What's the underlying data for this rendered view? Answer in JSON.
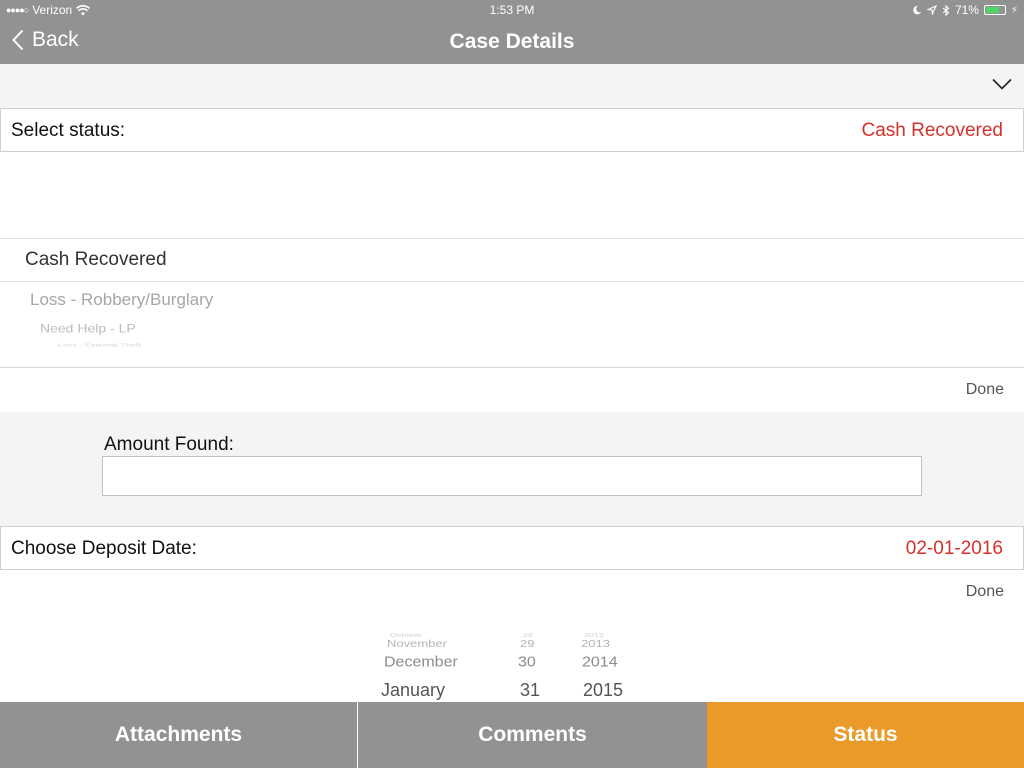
{
  "status_bar": {
    "carrier": "Verizon",
    "time": "1:53 PM",
    "battery": "71%",
    "battery_level": 0.71
  },
  "nav": {
    "back_label": "Back",
    "title": "Case Details"
  },
  "status_field": {
    "label": "Select status:",
    "value": "Cash Recovered"
  },
  "status_picker": {
    "selected": "Cash Recovered",
    "options_below": [
      "Loss - Robbery/Burglary",
      "Need Help - LP",
      "Loss - External Theft"
    ]
  },
  "status_done": "Done",
  "amount": {
    "label": "Amount Found:",
    "value": "",
    "placeholder": ""
  },
  "deposit_date": {
    "label": "Choose Deposit Date:",
    "value": "02-01-2016"
  },
  "date_done": "Done",
  "date_picker": {
    "months": [
      "October",
      "November",
      "December",
      "January"
    ],
    "days": [
      "28",
      "29",
      "30",
      "31"
    ],
    "years": [
      "2012",
      "2013",
      "2014",
      "2015"
    ]
  },
  "tabs": [
    {
      "label": "Attachments",
      "active": false
    },
    {
      "label": "Comments",
      "active": false
    },
    {
      "label": "Status",
      "active": true
    }
  ],
  "colors": {
    "bar_gray": "#929292",
    "accent_red": "#d6302a",
    "active_tab_orange": "#e99a28",
    "battery_green": "#4cd964"
  }
}
